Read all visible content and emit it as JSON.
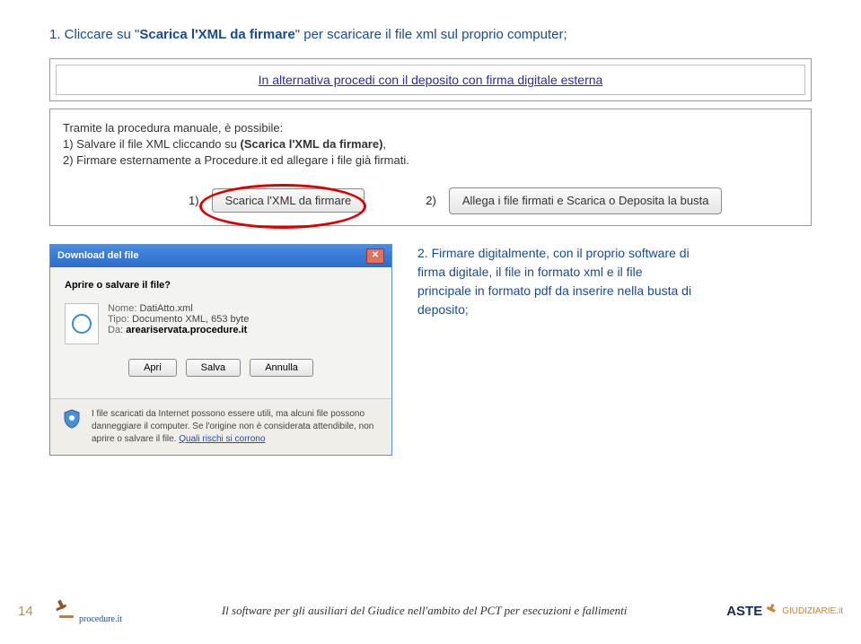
{
  "step1_prefix": "1. Cliccare su \"",
  "step1_bold": "Scarica l'XML da firmare",
  "step1_suffix": "\" per scaricare il file xml sul proprio computer;",
  "alt_link": "In alternativa procedi con il deposito con firma digitale esterna",
  "procedure_text": {
    "intro": "Tramite la procedura manuale, è possibile:",
    "line1a": "1) Salvare il file XML cliccando su ",
    "line1b": "(Scarica l'XML da firmare)",
    "line1c": ",",
    "line2": "2) Firmare esternamente a Procedure.it ed allegare i file già firmati."
  },
  "btn1_num": "1)",
  "btn1": "Scarica l'XML da firmare",
  "btn2_num": "2)",
  "btn2": "Allega i file firmati e Scarica o Deposita la busta",
  "dialog": {
    "title": "Download del file",
    "question": "Aprire o salvare il file?",
    "name_lbl": "Nome:",
    "name_val": "DatiAtto.xml",
    "type_lbl": "Tipo:",
    "type_val": "Documento XML, 653 byte",
    "from_lbl": "Da:",
    "from_val": "areariservata.procedure.it",
    "apri": "Apri",
    "salva": "Salva",
    "annulla": "Annulla",
    "warn": "I file scaricati da Internet possono essere utili, ma alcuni file possono danneggiare il computer. Se l'origine non è considerata attendibile, non aprire o salvare il file. ",
    "warn_link": "Quali rischi si corrono"
  },
  "step2": "2. Firmare digitalmente, con il proprio software di firma digitale, il file in formato xml e il file principale in formato pdf da inserire nella busta di deposito;",
  "footer": {
    "page": "14",
    "logo_left": "procedure.it",
    "title": "Il software per gli ausiliari del Giudice nell'ambito del PCT per esecuzioni e fallimenti",
    "logo_r1": "ASTE",
    "logo_r2": "GIUDIZIARIE.it"
  }
}
